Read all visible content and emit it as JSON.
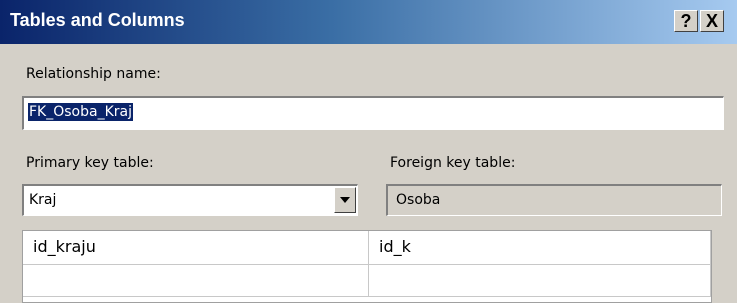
{
  "window": {
    "title": "Tables and Columns",
    "help_glyph": "?",
    "close_glyph": "X"
  },
  "relationship": {
    "label": "Relationship name:",
    "value": "FK_Osoba_Kraj"
  },
  "primary": {
    "label": "Primary key table:",
    "value": "Kraj"
  },
  "foreign": {
    "label": "Foreign key table:",
    "value": "Osoba"
  },
  "columns": {
    "rows": [
      [
        "id_kraju",
        "id_k"
      ],
      [
        "",
        ""
      ]
    ]
  },
  "colors": {
    "title_bar_start": "#0a246a",
    "title_bar_end": "#a6caf0",
    "dialog_bg": "#d4d0c8",
    "selection": "#0a246a"
  }
}
